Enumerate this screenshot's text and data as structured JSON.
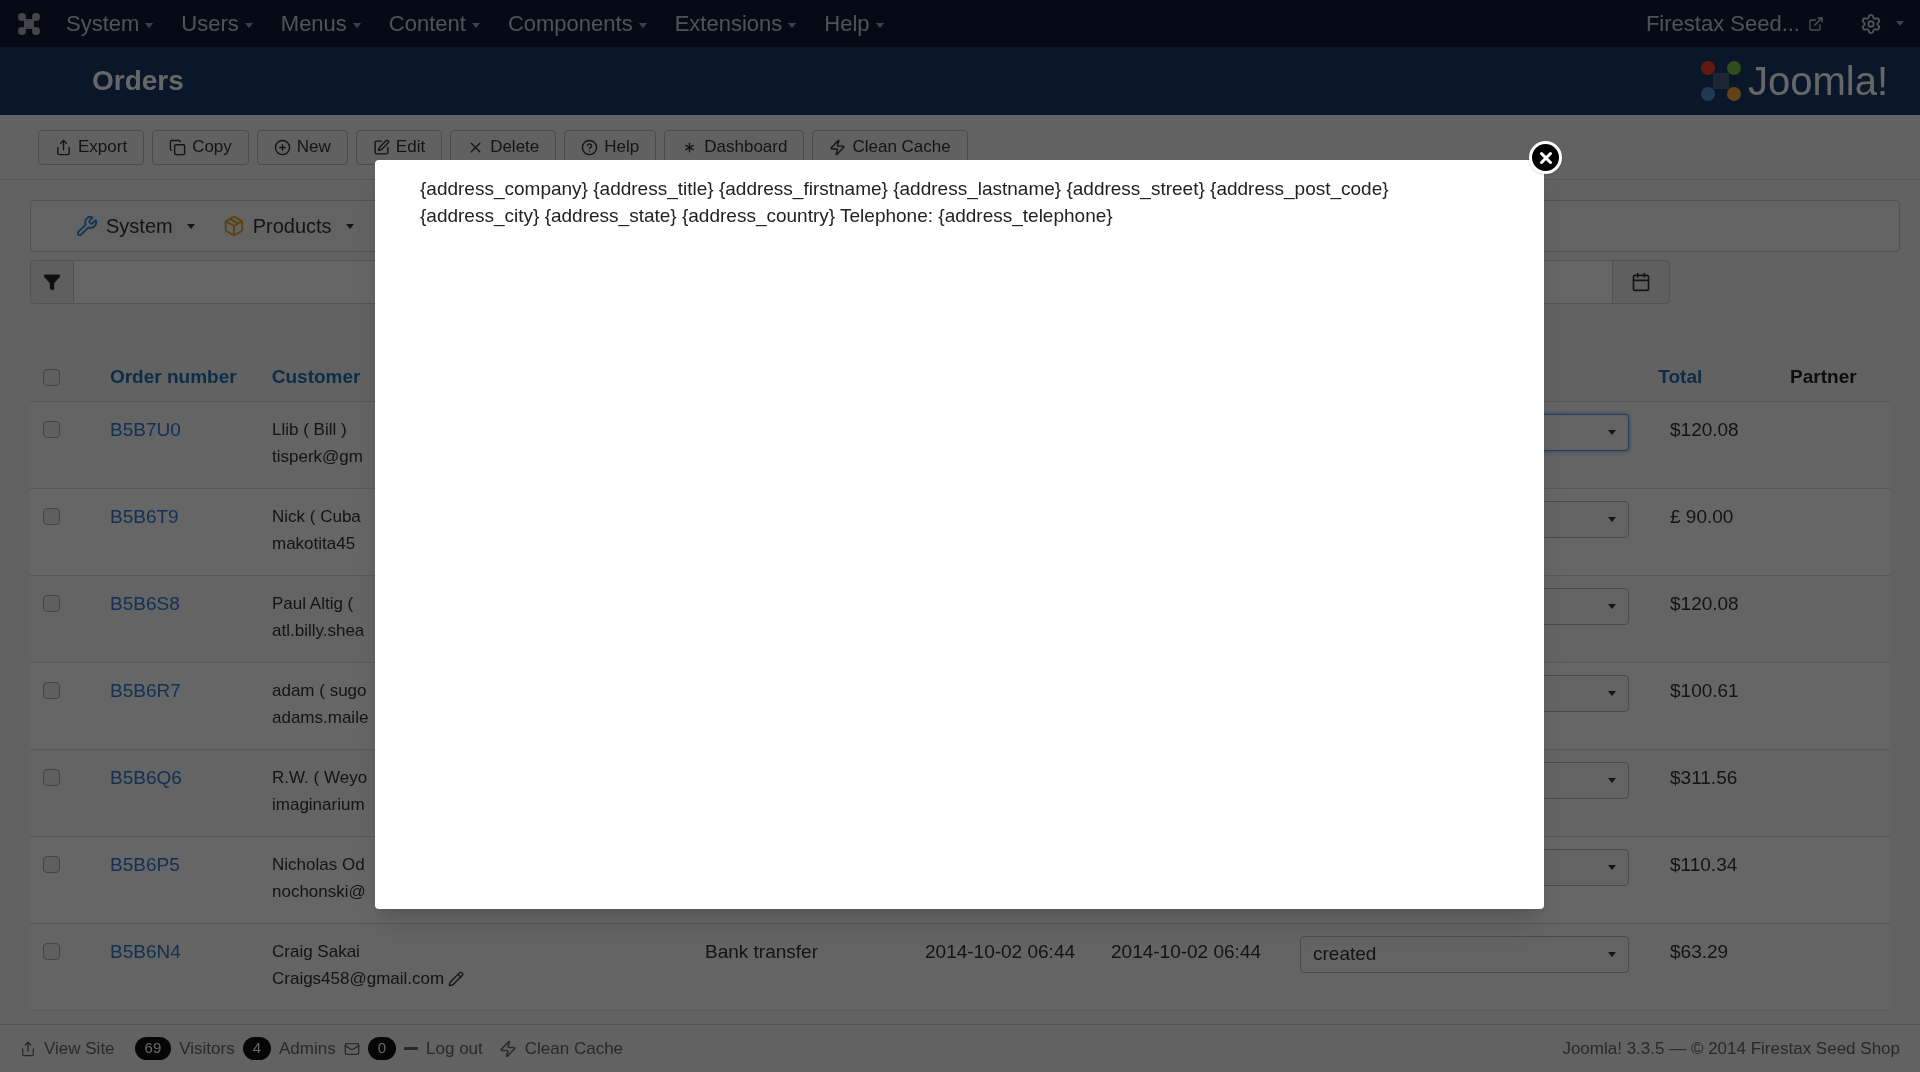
{
  "top_menu": [
    {
      "label": "System"
    },
    {
      "label": "Users"
    },
    {
      "label": "Menus"
    },
    {
      "label": "Content"
    },
    {
      "label": "Components"
    },
    {
      "label": "Extensions"
    },
    {
      "label": "Help"
    }
  ],
  "site_link": "Firestax Seed...",
  "page_title": "Orders",
  "logo_text": "Joomla!",
  "toolbar": [
    {
      "label": "Export"
    },
    {
      "label": "Copy"
    },
    {
      "label": "New"
    },
    {
      "label": "Edit"
    },
    {
      "label": "Delete"
    },
    {
      "label": "Help"
    },
    {
      "label": "Dashboard"
    },
    {
      "label": "Clean Cache"
    }
  ],
  "submenu": [
    {
      "label": "System"
    },
    {
      "label": "Products"
    }
  ],
  "table": {
    "all_selected": false,
    "columns": [
      {
        "label": "Order number",
        "kind": "sortable"
      },
      {
        "label": "Customer",
        "kind": "sortable"
      },
      {
        "label": "Total",
        "kind": "sortable"
      },
      {
        "label": "Partner",
        "kind": "plain"
      }
    ],
    "rows": [
      {
        "selected": false,
        "order": "B5B7U0",
        "customer_name": "Llib ( Bill )",
        "customer_email": "tisperk@gm",
        "status_focused": true,
        "total": "$120.08"
      },
      {
        "selected": false,
        "order": "B5B6T9",
        "customer_name": "Nick ( Cuba",
        "customer_email": "makotita45",
        "status_focused": false,
        "total": "£ 90.00"
      },
      {
        "selected": false,
        "order": "B5B6S8",
        "customer_name": "Paul Altig (",
        "customer_email": "atl.billy.shea",
        "status_focused": false,
        "total": "$120.08"
      },
      {
        "selected": false,
        "order": "B5B6R7",
        "customer_name": "adam ( sugo",
        "customer_email": "adams.maile",
        "status_focused": false,
        "total": "$100.61"
      },
      {
        "selected": false,
        "order": "B5B6Q6",
        "customer_name": "R.W. ( Weyo",
        "customer_email": "imaginarium",
        "status_focused": false,
        "total": "$311.56"
      },
      {
        "selected": false,
        "order": "B5B6P5",
        "customer_name": "Nicholas Od",
        "customer_email": "nochonski@",
        "status_focused": false,
        "total": "$110.34"
      },
      {
        "selected": false,
        "order": "B5B6N4",
        "customer_name": "Craig Sakai",
        "customer_email": "Craigs458@gmail.com",
        "payment": "Bank transfer",
        "created": "2014-10-02 06:44",
        "modified": "2014-10-02 06:44",
        "status": "created",
        "status_focused": false,
        "total": "$63.29"
      }
    ]
  },
  "modal": {
    "text": "{address_company} {address_title} {address_firstname} {address_lastname} {address_street} {address_post_code} {address_city} {address_state} {address_country} Telephone: {address_telephone}"
  },
  "footer": {
    "view_site": "View Site",
    "visitors_count": "69",
    "visitors": "Visitors",
    "admins_count": "4",
    "admins": "Admins",
    "messages_count": "0",
    "logout": "Log out",
    "clean_cache": "Clean Cache",
    "version": "Joomla! 3.3.5 — © 2014 Firestax Seed Shop"
  }
}
